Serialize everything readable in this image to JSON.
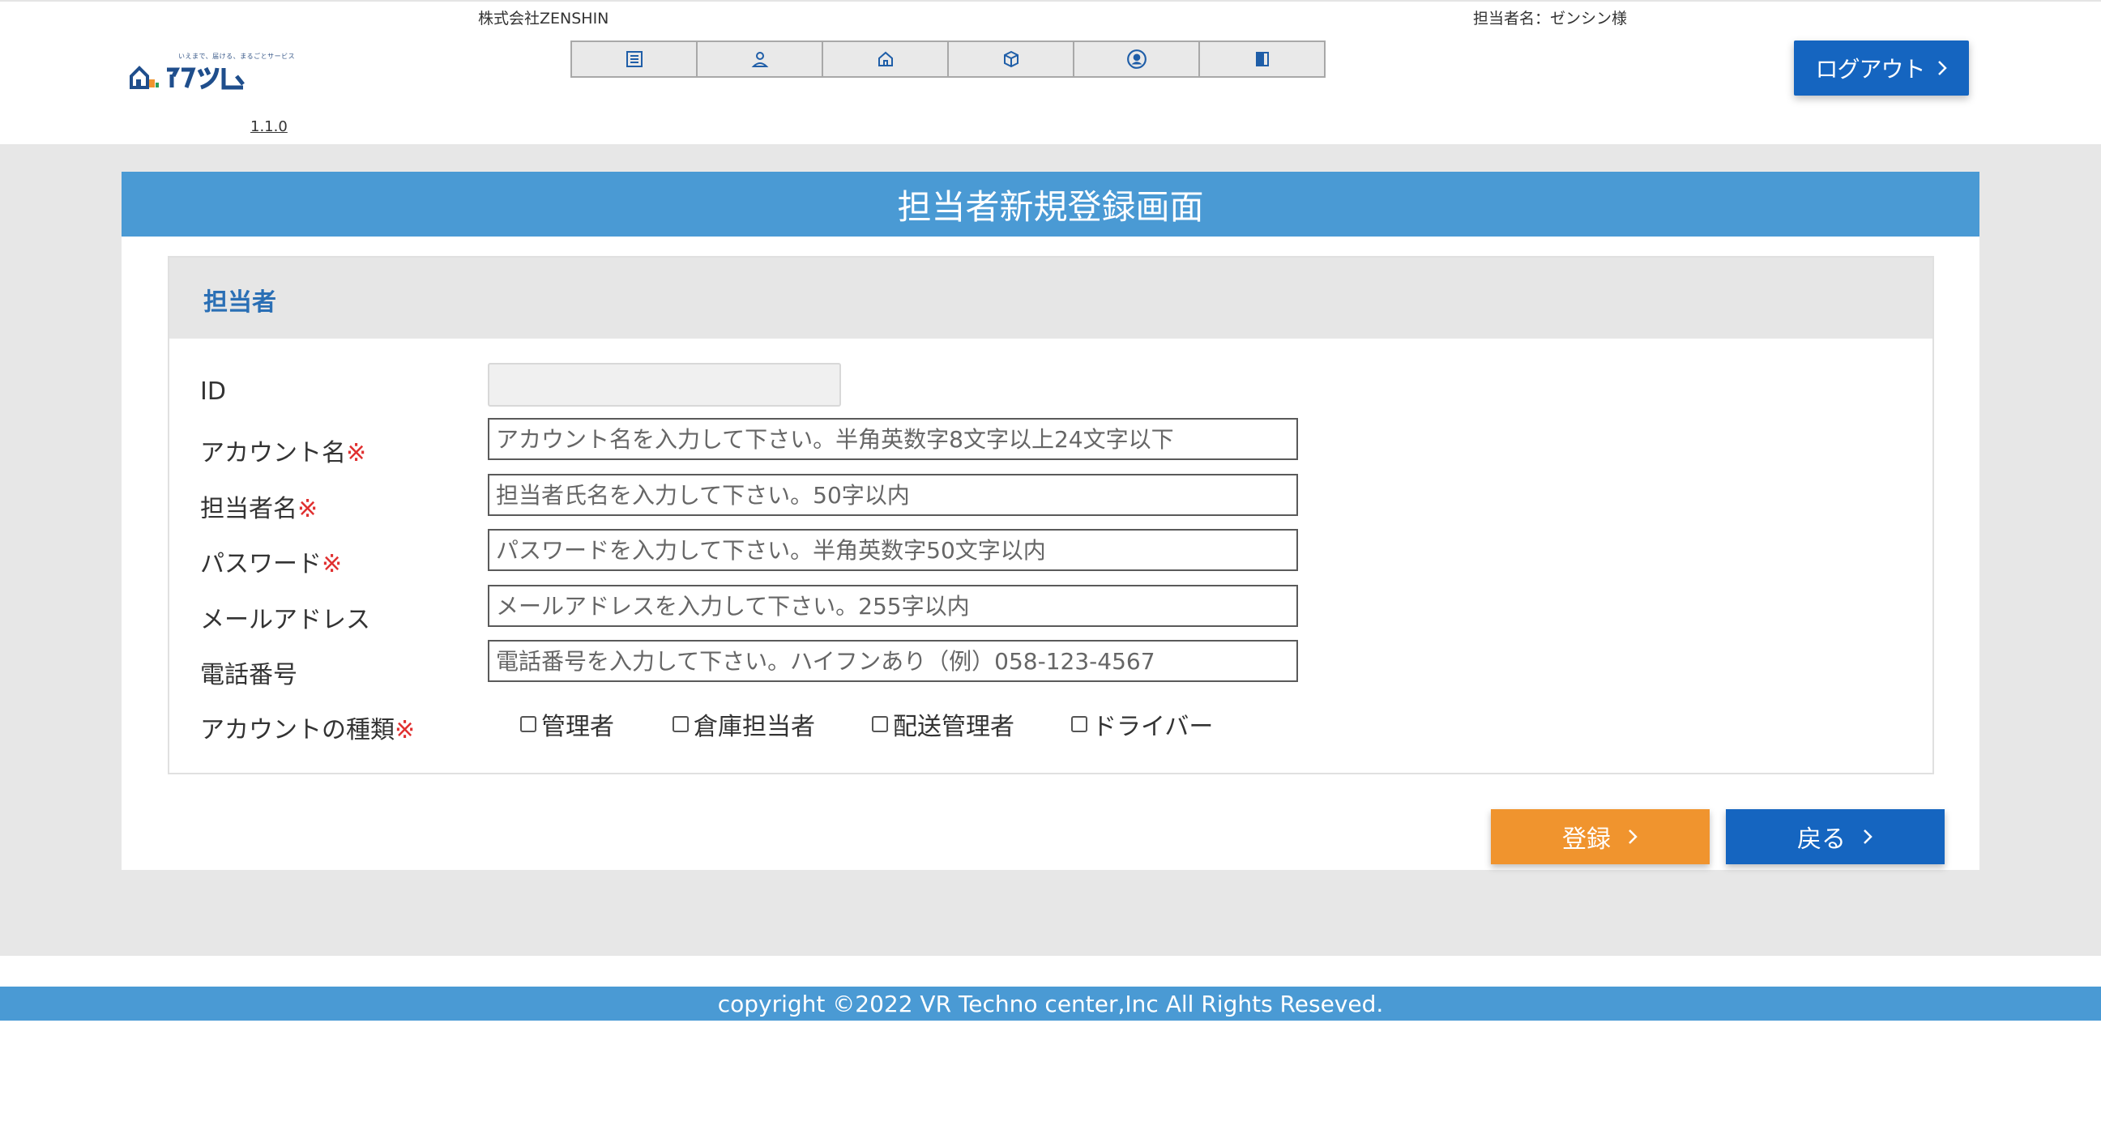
{
  "header": {
    "logo_tagline": "いえまで、届ける、まるごとサービス",
    "logo_text": "イマゾム",
    "version": "1.1.0",
    "company": "株式会社ZENSHIN",
    "staff_label": "担当者名：ゼンシン様",
    "logout_label": "ログアウト",
    "nav_icons": [
      "list-icon",
      "person-icon",
      "home-icon",
      "package-icon",
      "account-circle-icon",
      "book-icon"
    ]
  },
  "page": {
    "title": "担当者新規登録画面",
    "section_title": "担当者"
  },
  "form": {
    "id_label": "ID",
    "account_label": "アカウント名",
    "account_placeholder": "アカウント名を入力して下さい。半角英数字8文字以上24文字以下",
    "name_label": "担当者名",
    "name_placeholder": "担当者氏名を入力して下さい。50字以内",
    "password_label": "パスワード",
    "password_placeholder": "パスワードを入力して下さい。半角英数字50文字以内",
    "email_label": "メールアドレス",
    "email_placeholder": "メールアドレスを入力して下さい。255字以内",
    "phone_label": "電話番号",
    "phone_placeholder": "電話番号を入力して下さい。ハイフンあり（例）058-123-4567",
    "type_label": "アカウントの種類",
    "required_mark": "※",
    "types": [
      "管理者",
      "倉庫担当者",
      "配送管理者",
      "ドライバー"
    ]
  },
  "buttons": {
    "register": "登録",
    "back": "戻る"
  },
  "footer": {
    "copyright": "copyright ©2022 VR Techno center,Inc All Rights Reseved."
  },
  "colors": {
    "title_bar": "#4a9ad4",
    "primary_button": "#1565c0",
    "register_button": "#f0942e",
    "required": "#e03030",
    "section_title": "#2a6fb5"
  }
}
